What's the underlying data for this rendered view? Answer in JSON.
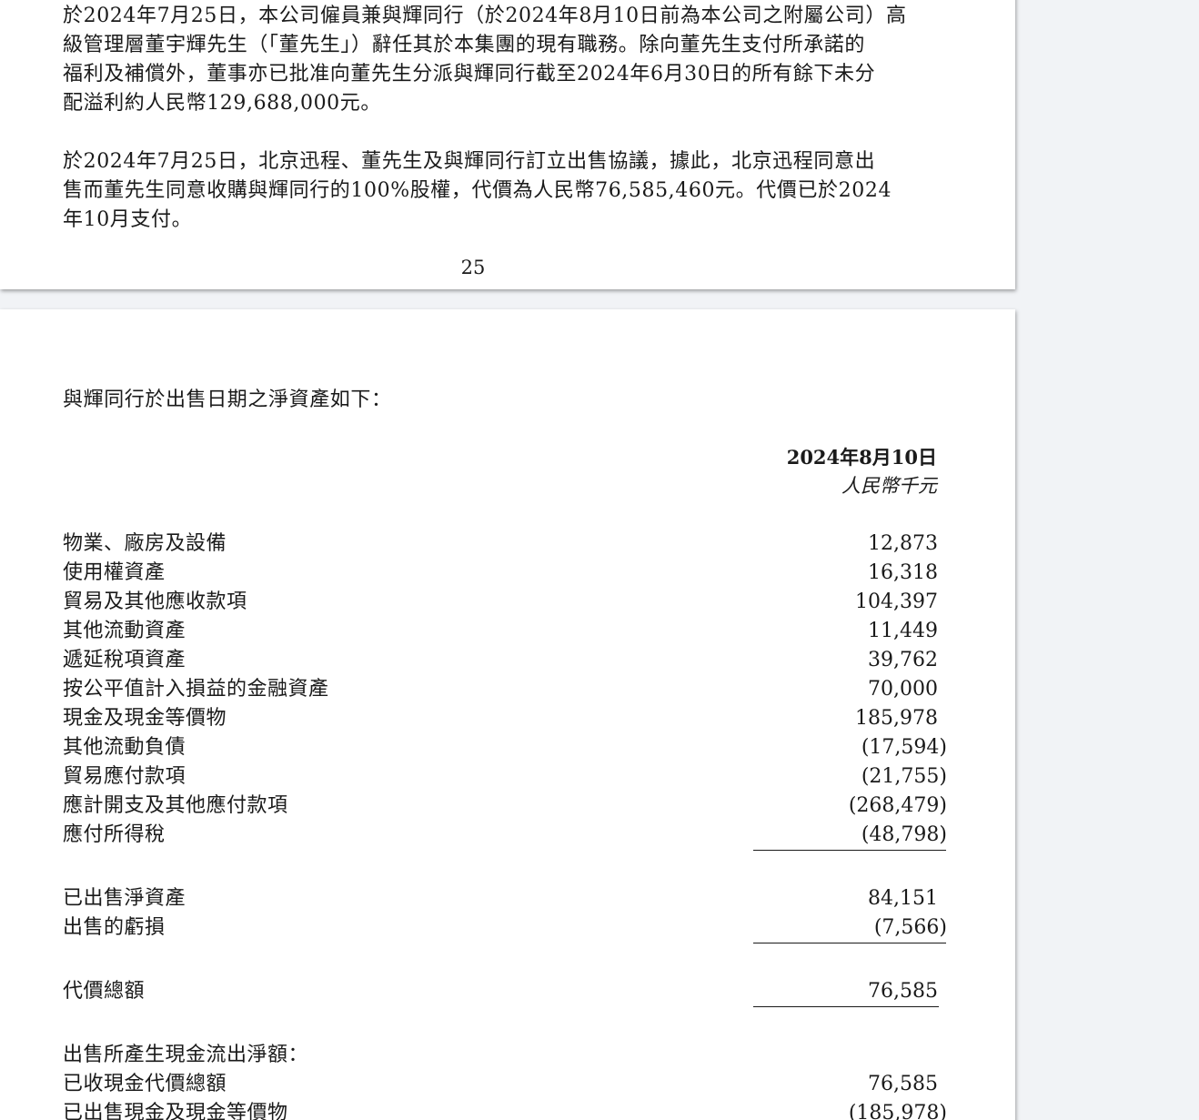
{
  "page1": {
    "para1": "於2024年7月25日，本公司僱員兼與輝同行（於2024年8月10日前為本公司之附屬公司）高\n級管理層董宇輝先生（「董先生」）辭任其於本集團的現有職務。除向董先生支付所承諾的\n福利及補償外，董事亦已批准向董先生分派與輝同行截至2024年6月30日的所有餘下未分\n配溢利約人民幣129,688,000元。",
    "para2": "於2024年7月25日，北京迅程、董先生及與輝同行訂立出售協議，據此，北京迅程同意出\n售而董先生同意收購與輝同行的100%股權，代價為人民幣76,585,460元。代價已於2024\n年10月支付。",
    "page_number": "25"
  },
  "page2": {
    "intro": "與輝同行於出售日期之淨資產如下：",
    "column_date": "2024年8月10日",
    "column_unit": "人民幣千元",
    "rows": [
      {
        "label": "物業、廠房及設備",
        "value": "12,873"
      },
      {
        "label": "使用權資產",
        "value": "16,318"
      },
      {
        "label": "貿易及其他應收款項",
        "value": "104,397"
      },
      {
        "label": "其他流動資產",
        "value": "11,449"
      },
      {
        "label": "遞延稅項資產",
        "value": "39,762"
      },
      {
        "label": "按公平值計入損益的金融資產",
        "value": "70,000"
      },
      {
        "label": "現金及現金等價物",
        "value": "185,978"
      },
      {
        "label": "其他流動負債",
        "value": "(17,594)"
      },
      {
        "label": "貿易應付款項",
        "value": "(21,755)"
      },
      {
        "label": "應計開支及其他應付款項",
        "value": "(268,479)"
      },
      {
        "label": "應付所得稅",
        "value": "(48,798)"
      },
      {
        "label": "已出售淨資產",
        "value": "84,151"
      },
      {
        "label": "出售的虧損",
        "value": "(7,566)"
      },
      {
        "label": "代價總額",
        "value": "76,585"
      },
      {
        "label": "出售所產生現金流出淨額：",
        "value": ""
      },
      {
        "label": "已收現金代價總額",
        "value": "76,585"
      },
      {
        "label": "已出售現金及現金等價物",
        "value": "(185,978)"
      }
    ]
  }
}
